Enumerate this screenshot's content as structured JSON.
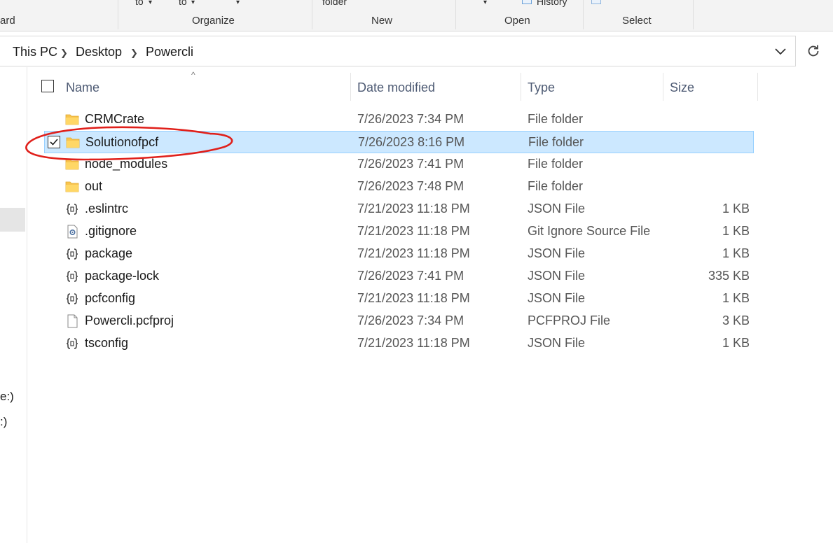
{
  "ribbon": {
    "fragments": {
      "clipboard_tail": "ard",
      "move_to": "to",
      "copy_to": "to",
      "new_folder": "folder",
      "history": "History"
    },
    "groups": [
      "Organize",
      "New",
      "Open",
      "Select"
    ]
  },
  "address": {
    "crumbs": [
      "This PC",
      "Desktop",
      "Powercli"
    ]
  },
  "nav": {
    "drive_fragment_1": "e:)",
    "drive_fragment_2": ":)"
  },
  "columns": {
    "name": "Name",
    "date": "Date modified",
    "type": "Type",
    "size": "Size"
  },
  "files": [
    {
      "name": "CRMCrate",
      "date": "7/26/2023 7:34 PM",
      "type": "File folder",
      "size": "",
      "icon": "folder-icon",
      "selected": false
    },
    {
      "name": "Solutionofpcf",
      "date": "7/26/2023 8:16 PM",
      "type": "File folder",
      "size": "",
      "icon": "folder-icon",
      "selected": true
    },
    {
      "name": "node_modules",
      "date": "7/26/2023 7:41 PM",
      "type": "File folder",
      "size": "",
      "icon": "folder-icon",
      "selected": false
    },
    {
      "name": "out",
      "date": "7/26/2023 7:48 PM",
      "type": "File folder",
      "size": "",
      "icon": "folder-icon",
      "selected": false
    },
    {
      "name": ".eslintrc",
      "date": "7/21/2023 11:18 PM",
      "type": "JSON File",
      "size": "1 KB",
      "icon": "json-file-icon",
      "selected": false
    },
    {
      "name": ".gitignore",
      "date": "7/21/2023 11:18 PM",
      "type": "Git Ignore Source File",
      "size": "1 KB",
      "icon": "settings-file-icon",
      "selected": false
    },
    {
      "name": "package",
      "date": "7/21/2023 11:18 PM",
      "type": "JSON File",
      "size": "1 KB",
      "icon": "json-file-icon",
      "selected": false
    },
    {
      "name": "package-lock",
      "date": "7/26/2023 7:41 PM",
      "type": "JSON File",
      "size": "335 KB",
      "icon": "json-file-icon",
      "selected": false
    },
    {
      "name": "pcfconfig",
      "date": "7/21/2023 11:18 PM",
      "type": "JSON File",
      "size": "1 KB",
      "icon": "json-file-icon",
      "selected": false
    },
    {
      "name": "Powercli.pcfproj",
      "date": "7/26/2023 7:34 PM",
      "type": "PCFPROJ File",
      "size": "3 KB",
      "icon": "blank-file-icon",
      "selected": false
    },
    {
      "name": "tsconfig",
      "date": "7/21/2023 11:18 PM",
      "type": "JSON File",
      "size": "1 KB",
      "icon": "json-file-icon",
      "selected": false
    }
  ],
  "colors": {
    "selection_bg": "#cce8ff",
    "selection_border": "#99d1ff",
    "annotation": "#e0201b",
    "folder": "#f8c44f"
  }
}
